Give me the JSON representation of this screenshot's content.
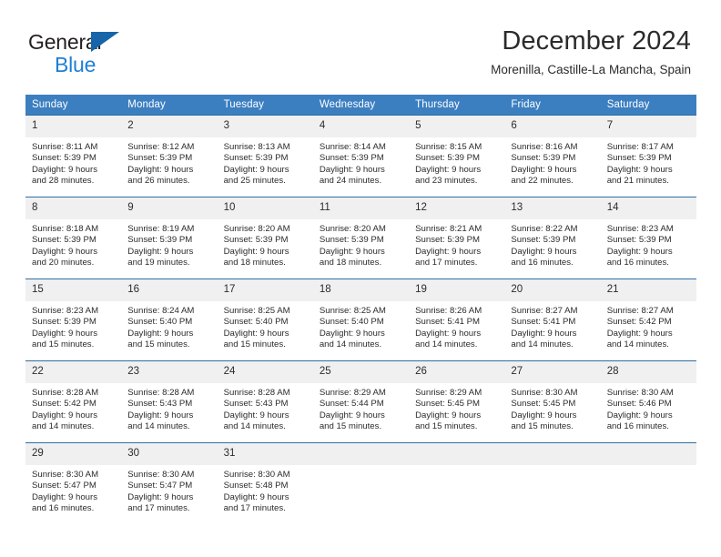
{
  "brand": {
    "name_part1": "General",
    "name_part2": "Blue",
    "triangle_color": "#1565a8",
    "blue_color": "#1f7fd4"
  },
  "header": {
    "title": "December 2024",
    "subtitle": "Morenilla, Castille-La Mancha, Spain"
  },
  "theme": {
    "header_bg": "#3c7fc1",
    "row_divider": "#2e6da4",
    "daynum_bg": "#f0f0f0",
    "text": "#2b2b2b"
  },
  "weekday_headers": [
    "Sunday",
    "Monday",
    "Tuesday",
    "Wednesday",
    "Thursday",
    "Friday",
    "Saturday"
  ],
  "weeks": [
    [
      {
        "day": "1",
        "sunrise": "Sunrise: 8:11 AM",
        "sunset": "Sunset: 5:39 PM",
        "daylight_line1": "Daylight: 9 hours",
        "daylight_line2": "and 28 minutes."
      },
      {
        "day": "2",
        "sunrise": "Sunrise: 8:12 AM",
        "sunset": "Sunset: 5:39 PM",
        "daylight_line1": "Daylight: 9 hours",
        "daylight_line2": "and 26 minutes."
      },
      {
        "day": "3",
        "sunrise": "Sunrise: 8:13 AM",
        "sunset": "Sunset: 5:39 PM",
        "daylight_line1": "Daylight: 9 hours",
        "daylight_line2": "and 25 minutes."
      },
      {
        "day": "4",
        "sunrise": "Sunrise: 8:14 AM",
        "sunset": "Sunset: 5:39 PM",
        "daylight_line1": "Daylight: 9 hours",
        "daylight_line2": "and 24 minutes."
      },
      {
        "day": "5",
        "sunrise": "Sunrise: 8:15 AM",
        "sunset": "Sunset: 5:39 PM",
        "daylight_line1": "Daylight: 9 hours",
        "daylight_line2": "and 23 minutes."
      },
      {
        "day": "6",
        "sunrise": "Sunrise: 8:16 AM",
        "sunset": "Sunset: 5:39 PM",
        "daylight_line1": "Daylight: 9 hours",
        "daylight_line2": "and 22 minutes."
      },
      {
        "day": "7",
        "sunrise": "Sunrise: 8:17 AM",
        "sunset": "Sunset: 5:39 PM",
        "daylight_line1": "Daylight: 9 hours",
        "daylight_line2": "and 21 minutes."
      }
    ],
    [
      {
        "day": "8",
        "sunrise": "Sunrise: 8:18 AM",
        "sunset": "Sunset: 5:39 PM",
        "daylight_line1": "Daylight: 9 hours",
        "daylight_line2": "and 20 minutes."
      },
      {
        "day": "9",
        "sunrise": "Sunrise: 8:19 AM",
        "sunset": "Sunset: 5:39 PM",
        "daylight_line1": "Daylight: 9 hours",
        "daylight_line2": "and 19 minutes."
      },
      {
        "day": "10",
        "sunrise": "Sunrise: 8:20 AM",
        "sunset": "Sunset: 5:39 PM",
        "daylight_line1": "Daylight: 9 hours",
        "daylight_line2": "and 18 minutes."
      },
      {
        "day": "11",
        "sunrise": "Sunrise: 8:20 AM",
        "sunset": "Sunset: 5:39 PM",
        "daylight_line1": "Daylight: 9 hours",
        "daylight_line2": "and 18 minutes."
      },
      {
        "day": "12",
        "sunrise": "Sunrise: 8:21 AM",
        "sunset": "Sunset: 5:39 PM",
        "daylight_line1": "Daylight: 9 hours",
        "daylight_line2": "and 17 minutes."
      },
      {
        "day": "13",
        "sunrise": "Sunrise: 8:22 AM",
        "sunset": "Sunset: 5:39 PM",
        "daylight_line1": "Daylight: 9 hours",
        "daylight_line2": "and 16 minutes."
      },
      {
        "day": "14",
        "sunrise": "Sunrise: 8:23 AM",
        "sunset": "Sunset: 5:39 PM",
        "daylight_line1": "Daylight: 9 hours",
        "daylight_line2": "and 16 minutes."
      }
    ],
    [
      {
        "day": "15",
        "sunrise": "Sunrise: 8:23 AM",
        "sunset": "Sunset: 5:39 PM",
        "daylight_line1": "Daylight: 9 hours",
        "daylight_line2": "and 15 minutes."
      },
      {
        "day": "16",
        "sunrise": "Sunrise: 8:24 AM",
        "sunset": "Sunset: 5:40 PM",
        "daylight_line1": "Daylight: 9 hours",
        "daylight_line2": "and 15 minutes."
      },
      {
        "day": "17",
        "sunrise": "Sunrise: 8:25 AM",
        "sunset": "Sunset: 5:40 PM",
        "daylight_line1": "Daylight: 9 hours",
        "daylight_line2": "and 15 minutes."
      },
      {
        "day": "18",
        "sunrise": "Sunrise: 8:25 AM",
        "sunset": "Sunset: 5:40 PM",
        "daylight_line1": "Daylight: 9 hours",
        "daylight_line2": "and 14 minutes."
      },
      {
        "day": "19",
        "sunrise": "Sunrise: 8:26 AM",
        "sunset": "Sunset: 5:41 PM",
        "daylight_line1": "Daylight: 9 hours",
        "daylight_line2": "and 14 minutes."
      },
      {
        "day": "20",
        "sunrise": "Sunrise: 8:27 AM",
        "sunset": "Sunset: 5:41 PM",
        "daylight_line1": "Daylight: 9 hours",
        "daylight_line2": "and 14 minutes."
      },
      {
        "day": "21",
        "sunrise": "Sunrise: 8:27 AM",
        "sunset": "Sunset: 5:42 PM",
        "daylight_line1": "Daylight: 9 hours",
        "daylight_line2": "and 14 minutes."
      }
    ],
    [
      {
        "day": "22",
        "sunrise": "Sunrise: 8:28 AM",
        "sunset": "Sunset: 5:42 PM",
        "daylight_line1": "Daylight: 9 hours",
        "daylight_line2": "and 14 minutes."
      },
      {
        "day": "23",
        "sunrise": "Sunrise: 8:28 AM",
        "sunset": "Sunset: 5:43 PM",
        "daylight_line1": "Daylight: 9 hours",
        "daylight_line2": "and 14 minutes."
      },
      {
        "day": "24",
        "sunrise": "Sunrise: 8:28 AM",
        "sunset": "Sunset: 5:43 PM",
        "daylight_line1": "Daylight: 9 hours",
        "daylight_line2": "and 14 minutes."
      },
      {
        "day": "25",
        "sunrise": "Sunrise: 8:29 AM",
        "sunset": "Sunset: 5:44 PM",
        "daylight_line1": "Daylight: 9 hours",
        "daylight_line2": "and 15 minutes."
      },
      {
        "day": "26",
        "sunrise": "Sunrise: 8:29 AM",
        "sunset": "Sunset: 5:45 PM",
        "daylight_line1": "Daylight: 9 hours",
        "daylight_line2": "and 15 minutes."
      },
      {
        "day": "27",
        "sunrise": "Sunrise: 8:30 AM",
        "sunset": "Sunset: 5:45 PM",
        "daylight_line1": "Daylight: 9 hours",
        "daylight_line2": "and 15 minutes."
      },
      {
        "day": "28",
        "sunrise": "Sunrise: 8:30 AM",
        "sunset": "Sunset: 5:46 PM",
        "daylight_line1": "Daylight: 9 hours",
        "daylight_line2": "and 16 minutes."
      }
    ],
    [
      {
        "day": "29",
        "sunrise": "Sunrise: 8:30 AM",
        "sunset": "Sunset: 5:47 PM",
        "daylight_line1": "Daylight: 9 hours",
        "daylight_line2": "and 16 minutes."
      },
      {
        "day": "30",
        "sunrise": "Sunrise: 8:30 AM",
        "sunset": "Sunset: 5:47 PM",
        "daylight_line1": "Daylight: 9 hours",
        "daylight_line2": "and 17 minutes."
      },
      {
        "day": "31",
        "sunrise": "Sunrise: 8:30 AM",
        "sunset": "Sunset: 5:48 PM",
        "daylight_line1": "Daylight: 9 hours",
        "daylight_line2": "and 17 minutes."
      },
      {
        "day": "",
        "sunrise": "",
        "sunset": "",
        "daylight_line1": "",
        "daylight_line2": ""
      },
      {
        "day": "",
        "sunrise": "",
        "sunset": "",
        "daylight_line1": "",
        "daylight_line2": ""
      },
      {
        "day": "",
        "sunrise": "",
        "sunset": "",
        "daylight_line1": "",
        "daylight_line2": ""
      },
      {
        "day": "",
        "sunrise": "",
        "sunset": "",
        "daylight_line1": "",
        "daylight_line2": ""
      }
    ]
  ]
}
